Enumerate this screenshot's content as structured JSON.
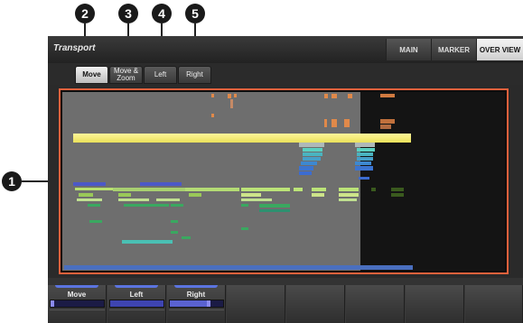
{
  "app": {
    "title": "Transport",
    "top_tabs": [
      "MAIN",
      "MARKER",
      "OVER VIEW"
    ],
    "active_top_tab": "OVER VIEW"
  },
  "sub_buttons": [
    {
      "label": "Move",
      "active": true
    },
    {
      "label": "Move & Zoom",
      "active": false
    },
    {
      "label": "Left",
      "active": false
    },
    {
      "label": "Right",
      "active": false
    }
  ],
  "callouts": [
    "1",
    "2",
    "3",
    "4",
    "5"
  ],
  "footer": {
    "pads": [
      {
        "label": "Move",
        "fill": 0.03
      },
      {
        "label": "Left",
        "fill": 0.0
      },
      {
        "label": "Right",
        "fill": 0.7
      },
      {
        "label": ""
      },
      {
        "label": ""
      },
      {
        "label": ""
      },
      {
        "label": ""
      },
      {
        "label": ""
      }
    ]
  },
  "colors": {
    "highlight_border": "#e8613c",
    "playhead": "#f2ec7a",
    "accent": "#5b74e0"
  }
}
